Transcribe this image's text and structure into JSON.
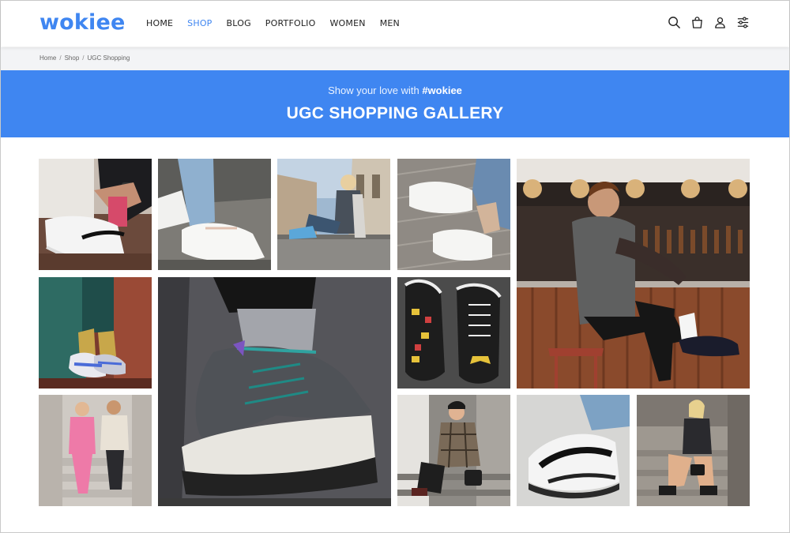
{
  "brand": {
    "name": "wokiee",
    "accent": "#3f86f1"
  },
  "nav": {
    "items": [
      {
        "label": "HOME",
        "active": false
      },
      {
        "label": "SHOP",
        "active": true
      },
      {
        "label": "BLOG",
        "active": false
      },
      {
        "label": "PORTFOLIO",
        "active": false
      },
      {
        "label": "WOMEN",
        "active": false
      },
      {
        "label": "MEN",
        "active": false
      }
    ]
  },
  "header_icons": [
    "search-icon",
    "shopping-bag-icon",
    "user-icon",
    "settings-sliders-icon"
  ],
  "breadcrumb": [
    "Home",
    "Shop",
    "UGC Shopping"
  ],
  "banner": {
    "subtitle_prefix": "Show your love with",
    "hashtag": "#wokiee",
    "title": "UGC SHOPPING GALLERY"
  },
  "gallery": {
    "photos": [
      {
        "name": "photo-white-nike-sneaker-sitting"
      },
      {
        "name": "photo-white-reebok-sneakers-jeans"
      },
      {
        "name": "photo-woman-sitting-by-canal"
      },
      {
        "name": "photo-white-sneakers-metal-floor"
      },
      {
        "name": "photo-man-sitting-at-bar"
      },
      {
        "name": "photo-woman-colorful-sneakers"
      },
      {
        "name": "photo-timberland-hiking-sneaker"
      },
      {
        "name": "photo-batman-converse-sneakers"
      },
      {
        "name": "photo-couple-on-stairs"
      },
      {
        "name": "photo-woman-plaid-coat-steps"
      },
      {
        "name": "photo-white-black-chunky-sneaker"
      },
      {
        "name": "photo-woman-on-steps-handbag"
      }
    ]
  }
}
